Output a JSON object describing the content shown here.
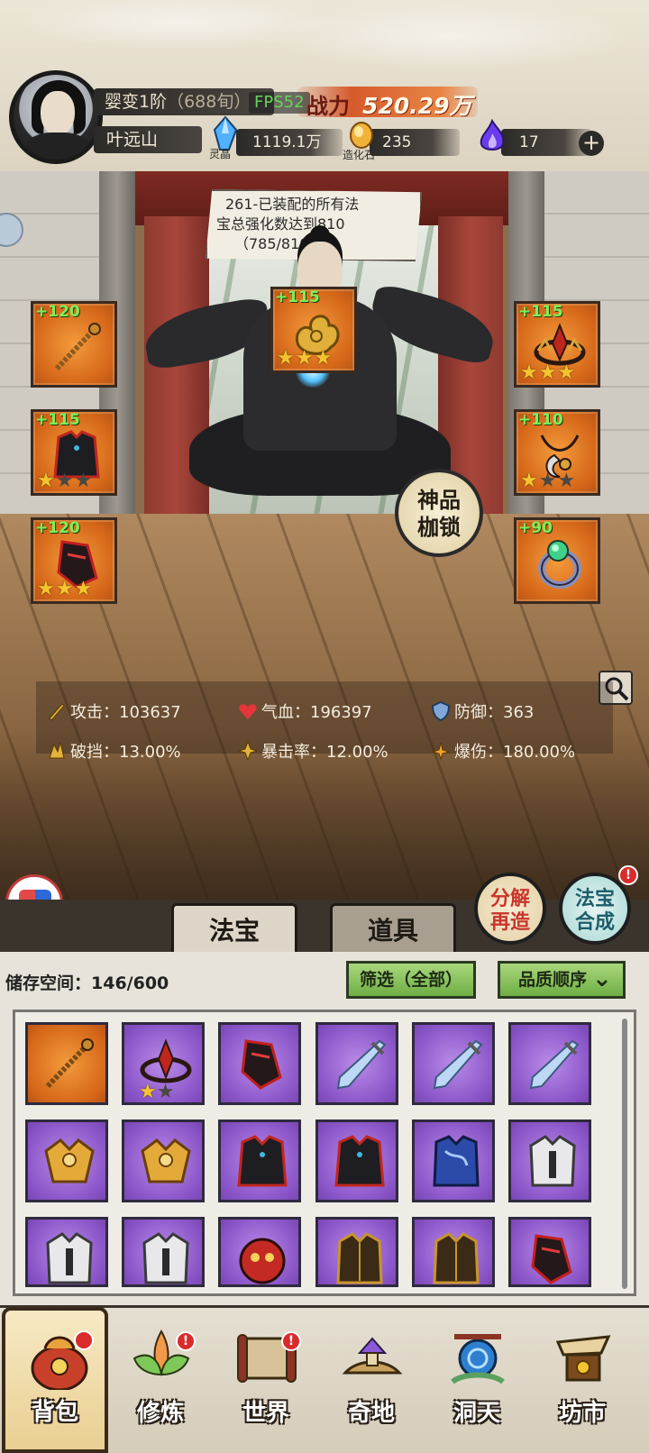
{
  "player": {
    "realm": "婴变1阶",
    "realm_sub": "（688旬）",
    "name": "叶远山",
    "fps_label": "FPS52",
    "power_label": "战力",
    "power_value": "520.29万"
  },
  "resources": [
    {
      "icon": "blue-crystal-icon",
      "caption": "灵晶",
      "value": "1119.1万"
    },
    {
      "icon": "creation-stone-icon",
      "caption": "造化石",
      "value": "235"
    },
    {
      "icon": "purple-flame-icon",
      "caption": "",
      "value": "17"
    }
  ],
  "quest": {
    "line1": "261-已装配的所有法",
    "line2": "宝总强化数达到810",
    "line3": "（785/810）"
  },
  "equipment": {
    "left_top": {
      "plus": "+120",
      "stars": 0,
      "icon": "staff-icon"
    },
    "left_mid": {
      "plus": "+115",
      "stars": 1,
      "icon": "dark-robe-icon"
    },
    "left_bot": {
      "plus": "+120",
      "stars": 3,
      "icon": "crimson-boots-icon"
    },
    "top_center": {
      "plus": "+115",
      "stars": 3,
      "icon": "golden-cloud-icon"
    },
    "right_top": {
      "plus": "+115",
      "stars": 3,
      "icon": "crown-icon"
    },
    "right_mid": {
      "plus": "+110",
      "stars": 1,
      "icon": "pendant-icon"
    },
    "right_bot": {
      "plus": "+90",
      "stars": 0,
      "icon": "jade-ring-icon"
    }
  },
  "seal_badge": {
    "line1": "神品",
    "line2": "枷锁"
  },
  "stats": [
    {
      "icon": "attack-icon",
      "label": "攻击：",
      "value": "103637"
    },
    {
      "icon": "heart-icon",
      "label": "气血：",
      "value": "196397"
    },
    {
      "icon": "shield-icon",
      "label": "防御：",
      "value": "363"
    },
    {
      "icon": "break-icon",
      "label": "破挡：",
      "value": "13.00%"
    },
    {
      "icon": "crit-icon",
      "label": "暴击率：",
      "value": "12.00%"
    },
    {
      "icon": "crit-damage-icon",
      "label": "爆伤：",
      "value": "180.00%"
    }
  ],
  "action_buttons": {
    "decompose": {
      "line1": "分解",
      "line2": "再造"
    },
    "merge": {
      "line1": "法宝",
      "line2": "合成",
      "alert": "!"
    }
  },
  "tabs": {
    "fabao": "法宝",
    "daoju": "道具"
  },
  "inventory": {
    "storage_label": "储存空间：146/600",
    "filter_label": "筛选（全部）",
    "sort_label": "品质顺序",
    "items": [
      {
        "rarity": "orange",
        "icon": "staff-icon",
        "stars": 0
      },
      {
        "rarity": "purple",
        "icon": "crown-icon",
        "stars": 1
      },
      {
        "rarity": "purple",
        "icon": "crimson-boots-icon",
        "stars": 0
      },
      {
        "rarity": "purple",
        "icon": "ice-sword-icon",
        "stars": 0
      },
      {
        "rarity": "purple",
        "icon": "ice-sword-icon",
        "stars": 0
      },
      {
        "rarity": "purple",
        "icon": "ice-sword-icon",
        "stars": 0
      },
      {
        "rarity": "purple",
        "icon": "golden-armor-icon",
        "stars": 0
      },
      {
        "rarity": "purple",
        "icon": "golden-armor-icon",
        "stars": 0
      },
      {
        "rarity": "purple",
        "icon": "dark-robe-icon",
        "stars": 0
      },
      {
        "rarity": "purple",
        "icon": "dark-robe-icon",
        "stars": 0
      },
      {
        "rarity": "purple",
        "icon": "blue-robe-icon",
        "stars": 0
      },
      {
        "rarity": "purple",
        "icon": "white-armor-icon",
        "stars": 0
      },
      {
        "rarity": "purple",
        "icon": "white-armor-icon",
        "stars": 0
      },
      {
        "rarity": "purple",
        "icon": "white-armor-icon",
        "stars": 0
      },
      {
        "rarity": "purple",
        "icon": "red-mask-icon",
        "stars": 0
      },
      {
        "rarity": "purple",
        "icon": "brown-robe-icon",
        "stars": 0
      },
      {
        "rarity": "purple",
        "icon": "brown-robe-icon",
        "stars": 0
      },
      {
        "rarity": "purple",
        "icon": "crimson-boots-icon",
        "stars": 0
      }
    ]
  },
  "bottom_nav": [
    {
      "label": "背包",
      "icon": "bag-icon",
      "alert": true,
      "active": true
    },
    {
      "label": "修炼",
      "icon": "lotus-icon",
      "alert": true,
      "active": false
    },
    {
      "label": "世界",
      "icon": "scroll-map-icon",
      "alert": true,
      "active": false
    },
    {
      "label": "奇地",
      "icon": "pavilion-icon",
      "alert": false,
      "active": false
    },
    {
      "label": "洞天",
      "icon": "portal-icon",
      "alert": false,
      "active": false
    },
    {
      "label": "坊市",
      "icon": "market-icon",
      "alert": false,
      "active": false
    }
  ],
  "colors": {
    "orange_rarity": "#d56719",
    "purple_rarity": "#8a55c8",
    "plus_green": "#7cf05a",
    "alert_red": "#d92b2b"
  }
}
